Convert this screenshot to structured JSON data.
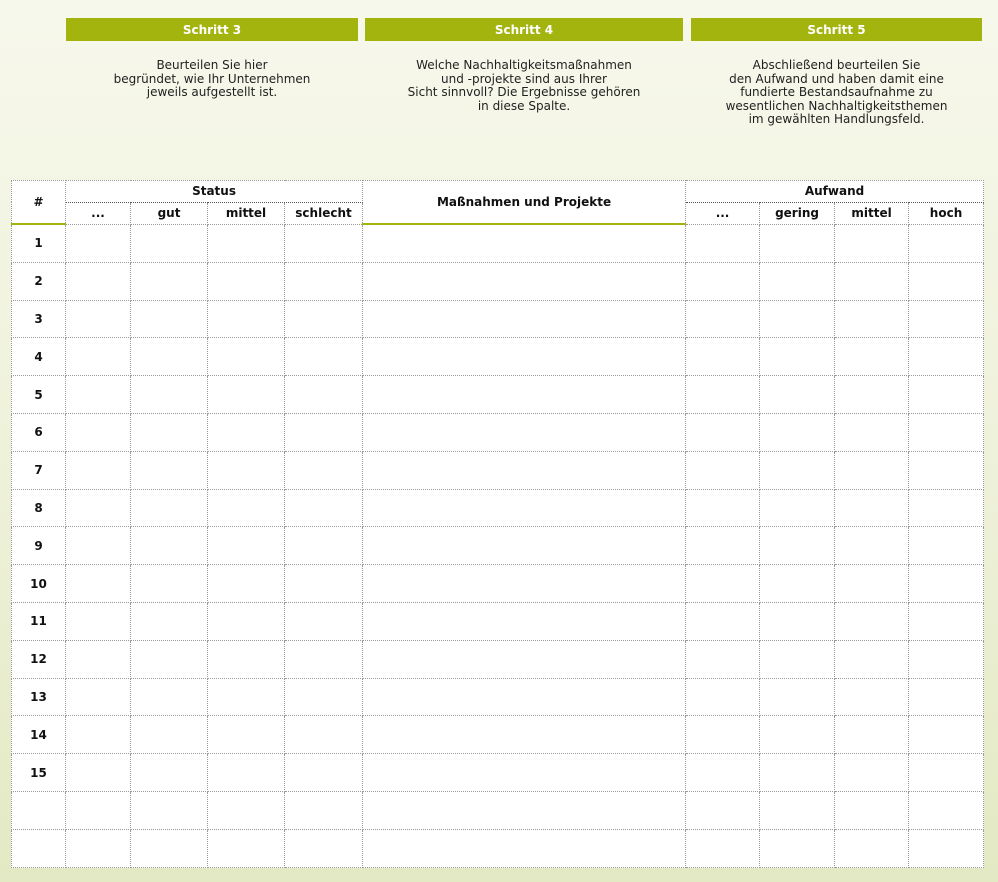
{
  "steps": [
    {
      "header": "Schritt 3",
      "lines": [
        "Beurteilen Sie hier",
        "begründet, wie Ihr Unternehmen",
        "jeweils aufgestellt ist."
      ]
    },
    {
      "header": "Schritt 4",
      "lines": [
        "Welche Nachhaltigkeitsmaßnahmen",
        "und -projekte sind aus Ihrer",
        "Sicht sinnvoll? Die Ergebnisse gehören",
        "in diese Spalte."
      ]
    },
    {
      "header": "Schritt 5",
      "lines": [
        "Abschließend beurteilen Sie",
        "den Aufwand und haben damit eine",
        "fundierte Bestandsaufnahme zu",
        "wesentlichen Nachhaltigkeitsthemen",
        "im gewählten Handlungsfeld."
      ]
    }
  ],
  "table": {
    "num_header": "#",
    "status_header": "Status",
    "status_cols": [
      "...",
      "gut",
      "mittel",
      "schlecht"
    ],
    "measures_header": "Maßnahmen und Projekte",
    "effort_header": "Aufwand",
    "effort_cols": [
      "...",
      "gering",
      "mittel",
      "hoch"
    ],
    "rows": [
      "1",
      "2",
      "3",
      "4",
      "5",
      "6",
      "7",
      "8",
      "9",
      "10",
      "11",
      "12",
      "13",
      "14",
      "15",
      "",
      ""
    ]
  },
  "colors": {
    "accent": "#a4b40f",
    "background_top": "#f7f8ec",
    "background_bottom": "#e3e9c3"
  }
}
